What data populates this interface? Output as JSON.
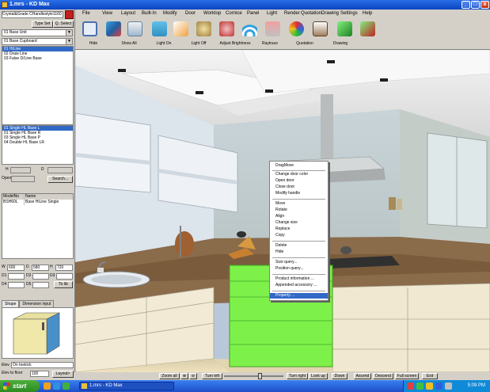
{
  "window": {
    "title": "1.mrs - KD Max",
    "min": "_",
    "max": "□",
    "close": "x"
  },
  "left": {
    "title": "Crystal&Grade CHandlestyle1160",
    "type_set": "Type Set",
    "q_select": "Q. Select",
    "combo1": "01 Base Unit",
    "combo2": "01 Base Cupboard",
    "list1": [
      "01 HiLine",
      "02 Draw Line",
      "03 False D/Line Base"
    ],
    "list1_selected": 0,
    "list2": [
      "01 Single HL Base L",
      "01 Single HL Base R",
      "03 Single HL Base P",
      "04 Double HL Base LR"
    ],
    "list2_selected": 0,
    "h_label": "H",
    "d_label": "D",
    "open_label": "Open",
    "search": "Search...",
    "grid_headers": [
      "ModelNo",
      "Name"
    ],
    "grid_rows": [
      [
        "BSH60L",
        "Base HiLine Single"
      ]
    ],
    "w_label": "W",
    "w_value": "600",
    "d_label2": "D",
    "d_value": "580",
    "h_label2": "H",
    "h_value": "720",
    "d1_label": "D1",
    "d2_label": "D2",
    "d3_label": "D3",
    "d4_label": "D4",
    "d5_label": "D5",
    "to_lib": "To lib",
    "tab_shape": "Shape",
    "tab_dim": "Dimension input",
    "elev_label": "Elev",
    "elev_value": "On toekick",
    "elev_floor_label": "Elev to floor",
    "elev_floor_value": "100",
    "layout_btn": "Layout>"
  },
  "menu": [
    "File",
    "View",
    "Layout",
    "Built-In",
    "Modify",
    "Door",
    "Worktop",
    "Cornice",
    "Panel",
    "Light",
    "Render",
    "Quotation",
    "Drawing",
    "Settings",
    "Help"
  ],
  "toolbar": {
    "labels": [
      "Hide",
      "Show All",
      "Light On",
      "Light Off",
      "Adjust Brightness",
      "Raytrace",
      "Quotation",
      "Drawing"
    ],
    "icons": [
      "select-frame-icon",
      "cube-icon",
      "show-all-icon",
      "books-icon",
      "eraser-icon",
      "paint-icon",
      "brush-icon",
      "wifi-icon",
      "lamp-icon",
      "palette-icon",
      "quotation-icon",
      "green-arrow-icon",
      "red-arrow-icon"
    ]
  },
  "context_menu": {
    "items": [
      "DragMove",
      "Change door color",
      "Open door",
      "Close door",
      "Modify handle",
      "Move",
      "Rotate",
      "Align",
      "Change size",
      "Replace",
      "Copy",
      "Delete",
      "Hide",
      "Size query...",
      "Position query...",
      "Product information ...",
      "Appended accessory ...",
      "Property ..."
    ],
    "selected": 17
  },
  "bottom": {
    "zoom_all": "Zoom all",
    "turn_left": "Turn left",
    "turn_right": "Turn right",
    "look_up": "Look up",
    "down": "Down",
    "ascend": "Ascend",
    "descend": "Descend",
    "full_screen": "Full screen",
    "exit": "Exit",
    "slider_value": 0.62
  },
  "taskbar": {
    "start": "start",
    "task": "1.mrs - KD Max",
    "clock": "5:09 PM"
  },
  "colors": {
    "accent": "#3169c6",
    "green_cabinet": "#7ef04a",
    "floor": "#e8d9b4",
    "worktop": "#8b6a48"
  }
}
